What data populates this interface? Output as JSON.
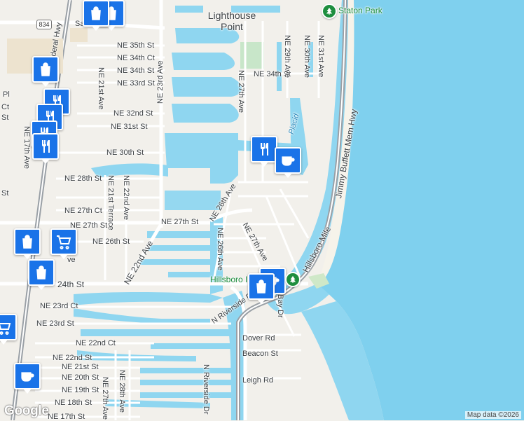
{
  "map": {
    "area_labels": {
      "city_line1": "Lighthouse",
      "city_line2": "Point",
      "park_top": "Staton Park",
      "park_bottom": "Hillsboro Inl"
    },
    "water_labels": {
      "lake": "Placid",
      "inlet": "Hillsboro Mile"
    },
    "streets": [
      "NE 35th St",
      "NE 34th Ct",
      "NE 34th St",
      "NE 33rd St",
      "NE 32nd St",
      "NE 31st St",
      "NE 30th St",
      "NE 28th St",
      "NE 27th Ct",
      "NE 27th St",
      "NE 27th St",
      "NE 26th St",
      "24th St",
      "NE 23rd Ct",
      "NE 23rd St",
      "NE 22nd Ct",
      "NE 22nd St",
      "NE 21st St",
      "NE 20th St",
      "NE 19th St",
      "NE 18th St",
      "NE 17th St",
      "NE 34th St",
      "NE 23rd Ave",
      "NE 21st Ave",
      "NE 22nd Ave",
      "NE 22nd Ave",
      "NE 21st Terrace",
      "NE 27th Ave",
      "NE 26th Ave",
      "NE 26th Ave",
      "NE 27th Ave",
      "NE 29th Ave",
      "NE 30th Ave",
      "NE 31st Ave",
      "NE 17th Ave",
      "NE 27th Ave",
      "NE 28th Ave",
      "Jimmy Buffett Mem Hwy",
      "N Riverside Dr",
      "N Riverside Dr",
      "Bay Dr",
      "Dover Rd",
      "Beacon St",
      "Leigh Rd",
      "Federal Hwy",
      "Sam",
      "Pl",
      "Ct",
      "St",
      "St",
      "ve"
    ],
    "route_shield": "834",
    "google_logo": "Google",
    "attribution": "Map data ©2026"
  },
  "colors": {
    "ocean": "#7fd0ee",
    "land": "#f2f0eb",
    "water": "#8fd6f0",
    "road_major": "#ffffff",
    "road_minor": "#ffffff",
    "hwy": "#9aa0a6",
    "park": "#c8e6c9",
    "poi": "#1a73e8"
  },
  "pois": [
    {
      "icon": "shopping-bag-icon"
    },
    {
      "icon": "shopping-bag-icon"
    },
    {
      "icon": "shopping-bag-icon"
    },
    {
      "icon": "restaurant-icon"
    },
    {
      "icon": "restaurant-icon"
    },
    {
      "icon": "restaurant-icon"
    },
    {
      "icon": "restaurant-icon"
    },
    {
      "icon": "coffee-icon"
    },
    {
      "icon": "shopping-bag-icon"
    },
    {
      "icon": "shopping-bag-icon"
    },
    {
      "icon": "grocery-cart-icon"
    },
    {
      "icon": "shopping-bag-icon"
    },
    {
      "icon": "coffee-icon"
    },
    {
      "icon": "coffee-icon"
    },
    {
      "icon": "shopping-bag-icon"
    },
    {
      "icon": "grocery-cart-icon"
    },
    {
      "icon": "park-tree-icon"
    },
    {
      "icon": "park-tree-icon"
    }
  ]
}
